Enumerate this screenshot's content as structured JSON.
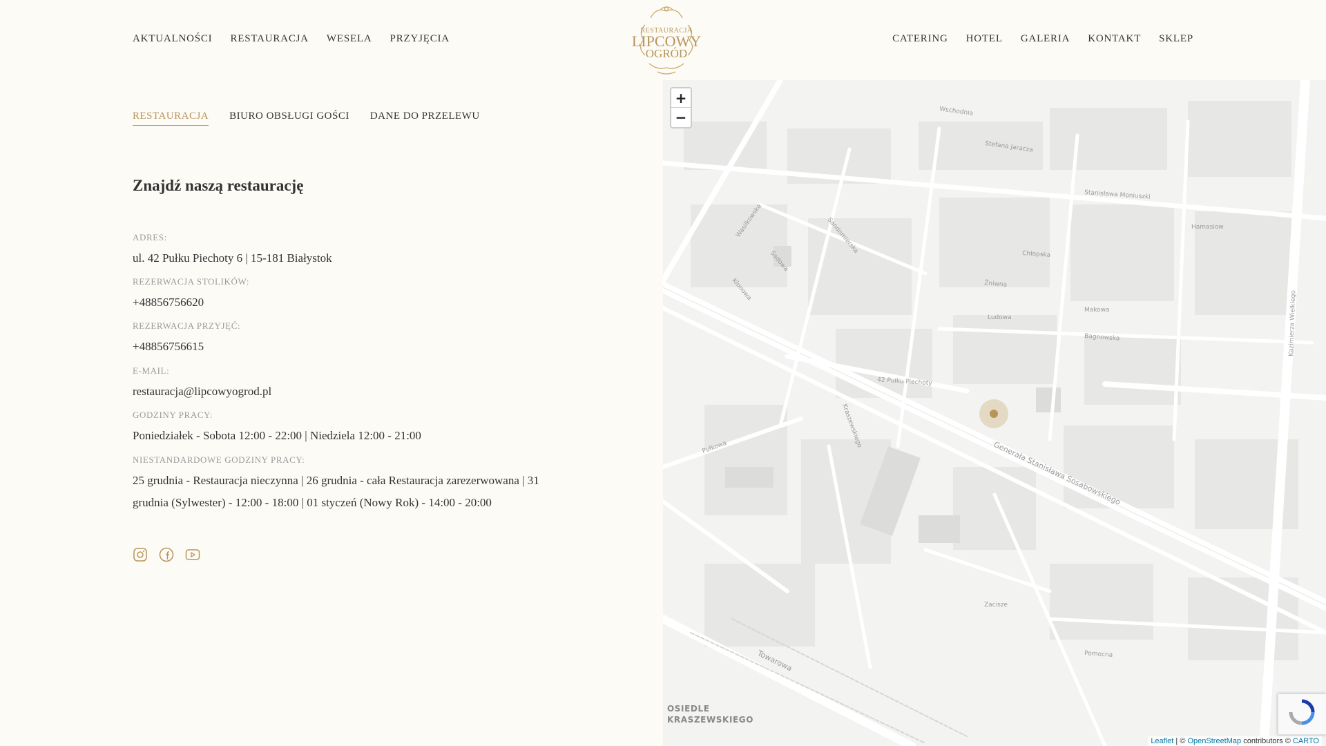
{
  "header": {
    "nav_left": [
      "AKTUALNOŚCI",
      "RESTAURACJA",
      "WESELA",
      "PRZYJĘCIA"
    ],
    "nav_right": [
      "CATERING",
      "HOTEL",
      "GALERIA",
      "KONTAKT",
      "SKLEP"
    ],
    "logo": {
      "line1": "RESTAURACJA",
      "line2": "LIPCOWY",
      "line3": "OGRÓD"
    }
  },
  "tabs": [
    "RESTAURACJA",
    "BIURO OBSŁUGI GOŚCI",
    "DANE DO PRZELEWU"
  ],
  "active_tab": 0,
  "heading": "Znajdź naszą restaurację",
  "info": [
    {
      "label": "ADRES:",
      "value": "ul. 42 Pułku Piechoty 6 | 15-181 Białystok"
    },
    {
      "label": "REZERWACJA STOLIKÓW:",
      "value": "+48856756620"
    },
    {
      "label": "REZERWACJA PRZYJĘĆ:",
      "value": "+48856756615"
    },
    {
      "label": "E-MAIL:",
      "value": "restauracja@lipcowyogrod.pl"
    },
    {
      "label": "GODZINY PRACY:",
      "value": "Poniedziałek - Sobota 12:00 - 22:00 | Niedziela 12:00 - 21:00"
    },
    {
      "label": "NIESTANDARDOWE GODZINY PRACY:",
      "value": "25 grudnia - Restauracja nieczynna | 26 grudnia - cała Restauracja zarezerwowana | 31 grudnia (Sylwester) - 12:00 - 18:00 | 01 styczeń (Nowy Rok) - 14:00 - 20:00"
    }
  ],
  "social_icons": [
    "instagram-icon",
    "facebook-icon",
    "youtube-icon"
  ],
  "map": {
    "zoom_in": "+",
    "zoom_out": "−",
    "place_label": "OSIEDLE KRASZEWSKIEGO",
    "streets": [
      "Wschodnia",
      "Stefana Jaracza",
      "Stanisława Moniuszki",
      "Hamasiow",
      "Chłopska",
      "Żniwna",
      "Ludowa",
      "Makowa",
      "Bagnowska",
      "42 Pułku Piechoty",
      "Generała Stanisława Sosabowskiego",
      "Pułkowa",
      "Zacisze",
      "Pomocna",
      "Towarowa",
      "Kazimierza Wielkiego",
      "Wasilkowska",
      "Sadowa",
      "Sandomierska",
      "Klonowa",
      "Kraszewskiego"
    ],
    "attribution": {
      "leaflet": "Leaflet",
      "sep": " | © ",
      "osm": "OpenStreetMap",
      "contrib": " contributors © ",
      "carto": "CARTO"
    }
  },
  "colors": {
    "accent": "#b8945a",
    "background": "#fdfbf6",
    "map_bg": "#f2f2f0"
  }
}
